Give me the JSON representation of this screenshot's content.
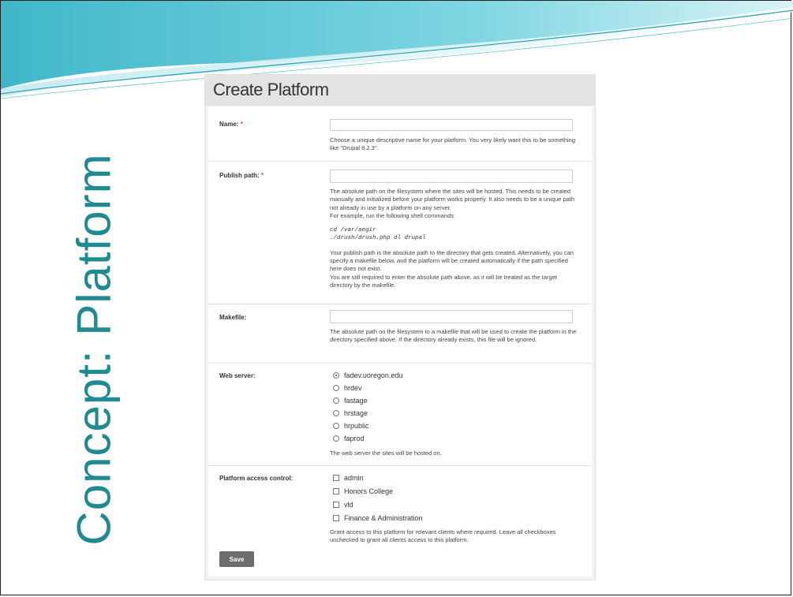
{
  "slide": {
    "title": "Concept: Platform",
    "accent_color": "#1f8a8f"
  },
  "form": {
    "title": "Create Platform",
    "name_field": {
      "label": "Name:",
      "required_mark": "*",
      "value": "",
      "description": "Choose a unique descriptive name for your platform. You very likely want this to be something like \"Drupal 8.2.3\"."
    },
    "publish_path": {
      "label": "Publish path:",
      "required_mark": "*",
      "value": "",
      "description_1": "The absolute path on the filesystem where the sites will be hosted. This needs to be created manually and initialized before your platform works properly. It also needs to be a unique path not already in use by a platform on any server.",
      "description_2": "For example, run the following shell commands:",
      "code_1": "cd /var/aegir",
      "code_2": "./drush/drush.php dl drupal",
      "description_3": "Your publish path is the absolute path to the directory that gets created. Alternatively, you can specify a makefile below, and the platform will be created automatically if the path specified here does not exist.",
      "description_4": "You are still required to enter the absolute path above, as it will be treated as the target directory by the makefile."
    },
    "makefile": {
      "label": "Makefile:",
      "value": "",
      "description": "The absolute path on the filesystem to a makefile that will be used to create the platform in the directory specified above. If the directory already exists, this file will be ignored."
    },
    "web_server": {
      "label": "Web server:",
      "options": [
        "fadev.uoregon.edu",
        "hrdev",
        "fastage",
        "hrstage",
        "hrpublic",
        "faprod"
      ],
      "selected": "fadev.uoregon.edu",
      "description": "The web server the sites will be hosted on."
    },
    "access_control": {
      "label": "Platform access control:",
      "options": [
        "admin",
        "Honors College",
        "vld",
        "Finance & Administration"
      ],
      "description": "Grant access to this platform for relevant clients where required. Leave all checkboxes unchecked to grant all clients access to this platform."
    },
    "save_label": "Save"
  }
}
